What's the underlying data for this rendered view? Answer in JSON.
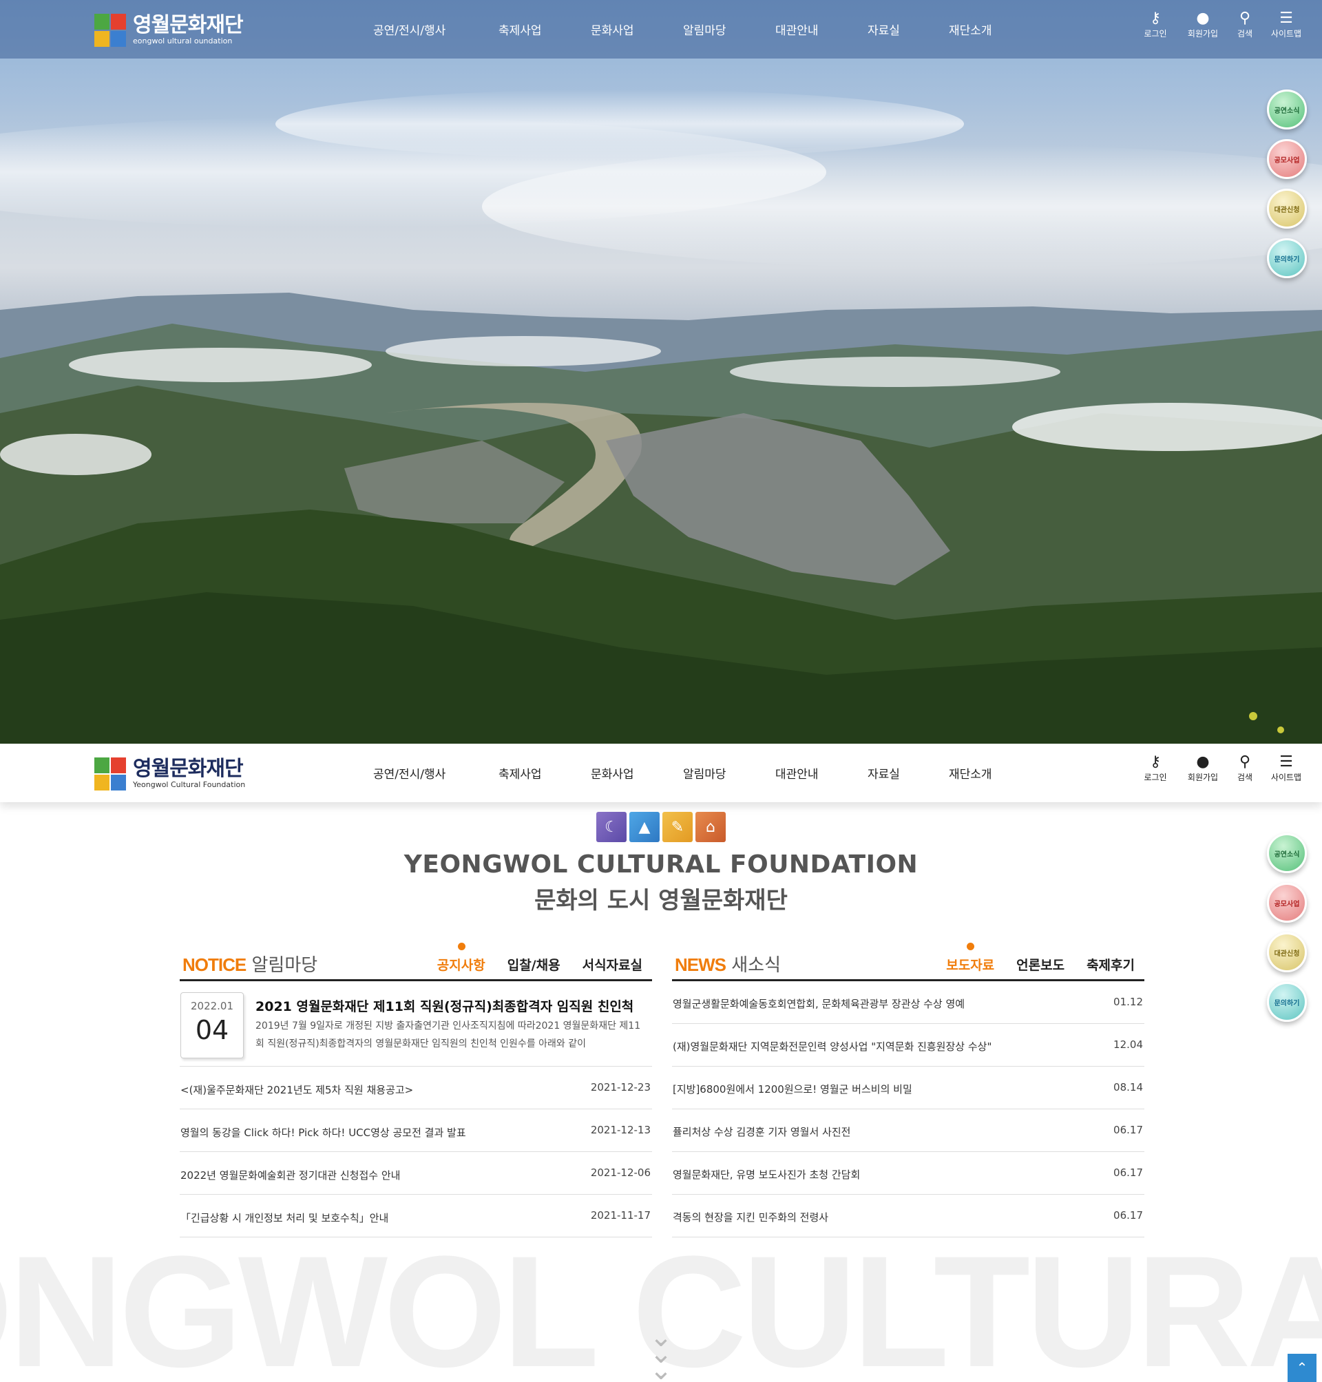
{
  "site": {
    "logo_ko": "영월문화재단",
    "logo_en_top": "eongwol  ultural  oundation",
    "logo_en_bottom": "Yeongwol Cultural Foundation"
  },
  "nav": {
    "items": [
      "공연/전시/행사",
      "축제사업",
      "문화사업",
      "알림마당",
      "대관안내",
      "자료실",
      "재단소개"
    ],
    "util": [
      {
        "label": "로그인",
        "icon": "key-icon"
      },
      {
        "label": "회원가입",
        "icon": "user-icon"
      },
      {
        "label": "검색",
        "icon": "search-icon"
      },
      {
        "label": "사이트맵",
        "icon": "menu-icon"
      }
    ]
  },
  "quick": [
    "공연소식",
    "공모사업",
    "대관신청",
    "문의하기"
  ],
  "intro": {
    "en": "YEONGWOL CULTURAL FOUNDATION",
    "ko": "문화의 도시 영월문화재단"
  },
  "notice": {
    "title_en": "NOTICE",
    "title_ko": "알림마당",
    "tabs": [
      "공지사항",
      "입찰/채용",
      "서식자료실"
    ],
    "feature": {
      "ym": "2022.01",
      "day": "04",
      "title": "2021 영월문화재단 제11회 직원(정규직)최종합격자 임직원 친인척",
      "desc": "2019년 7월 9일자로 개정된 지방 출자출연기관 인사조직지침에 따라2021 영월문화재단 제11회 직원(정규직)최종합격자의 영월문화재단 임직원의 친인척 인원수를 아래와 같이"
    },
    "rows": [
      {
        "title": "<(재)울주문화재단 2021년도 제5차 직원 채용공고>",
        "date": "2021-12-23"
      },
      {
        "title": "영월의 동강을 Click 하다! Pick 하다! UCC영상 공모전 결과 발표",
        "date": "2021-12-13"
      },
      {
        "title": "2022년 영월문화예술회관 정기대관 신청접수 안내",
        "date": "2021-12-06"
      },
      {
        "title": "「긴급상황 시 개인정보 처리 및 보호수칙」안내",
        "date": "2021-11-17"
      }
    ]
  },
  "news": {
    "title_en": "NEWS",
    "title_ko": "새소식",
    "tabs": [
      "보도자료",
      "언론보도",
      "축제후기"
    ],
    "rows": [
      {
        "title": "영월군생활문화예술동호회연합회, 문화체육관광부 장관상 수상 영예",
        "date": "01.12"
      },
      {
        "title": "(재)영월문화재단 지역문화전문인력 양성사업 \"지역문화 진흥원장상 수상\"",
        "date": "12.04"
      },
      {
        "title": "[지방]6800원에서 1200원으로! 영월군 버스비의 비밀",
        "date": "08.14"
      },
      {
        "title": "퓰리처상 수상 김경훈 기자 영월서 사진전",
        "date": "06.17"
      },
      {
        "title": "영월문화재단, 유명 보도사진가 초청 간담회",
        "date": "06.17"
      },
      {
        "title": "격동의 현장을 지킨 민주화의 전령사",
        "date": "06.17"
      }
    ]
  },
  "watermark": "ONGWOL CULTURAL FOUNDATION",
  "colors": {
    "accent": "#f07d0c",
    "navy": "#1d2c5e",
    "top_button": "#2e8ad0"
  }
}
